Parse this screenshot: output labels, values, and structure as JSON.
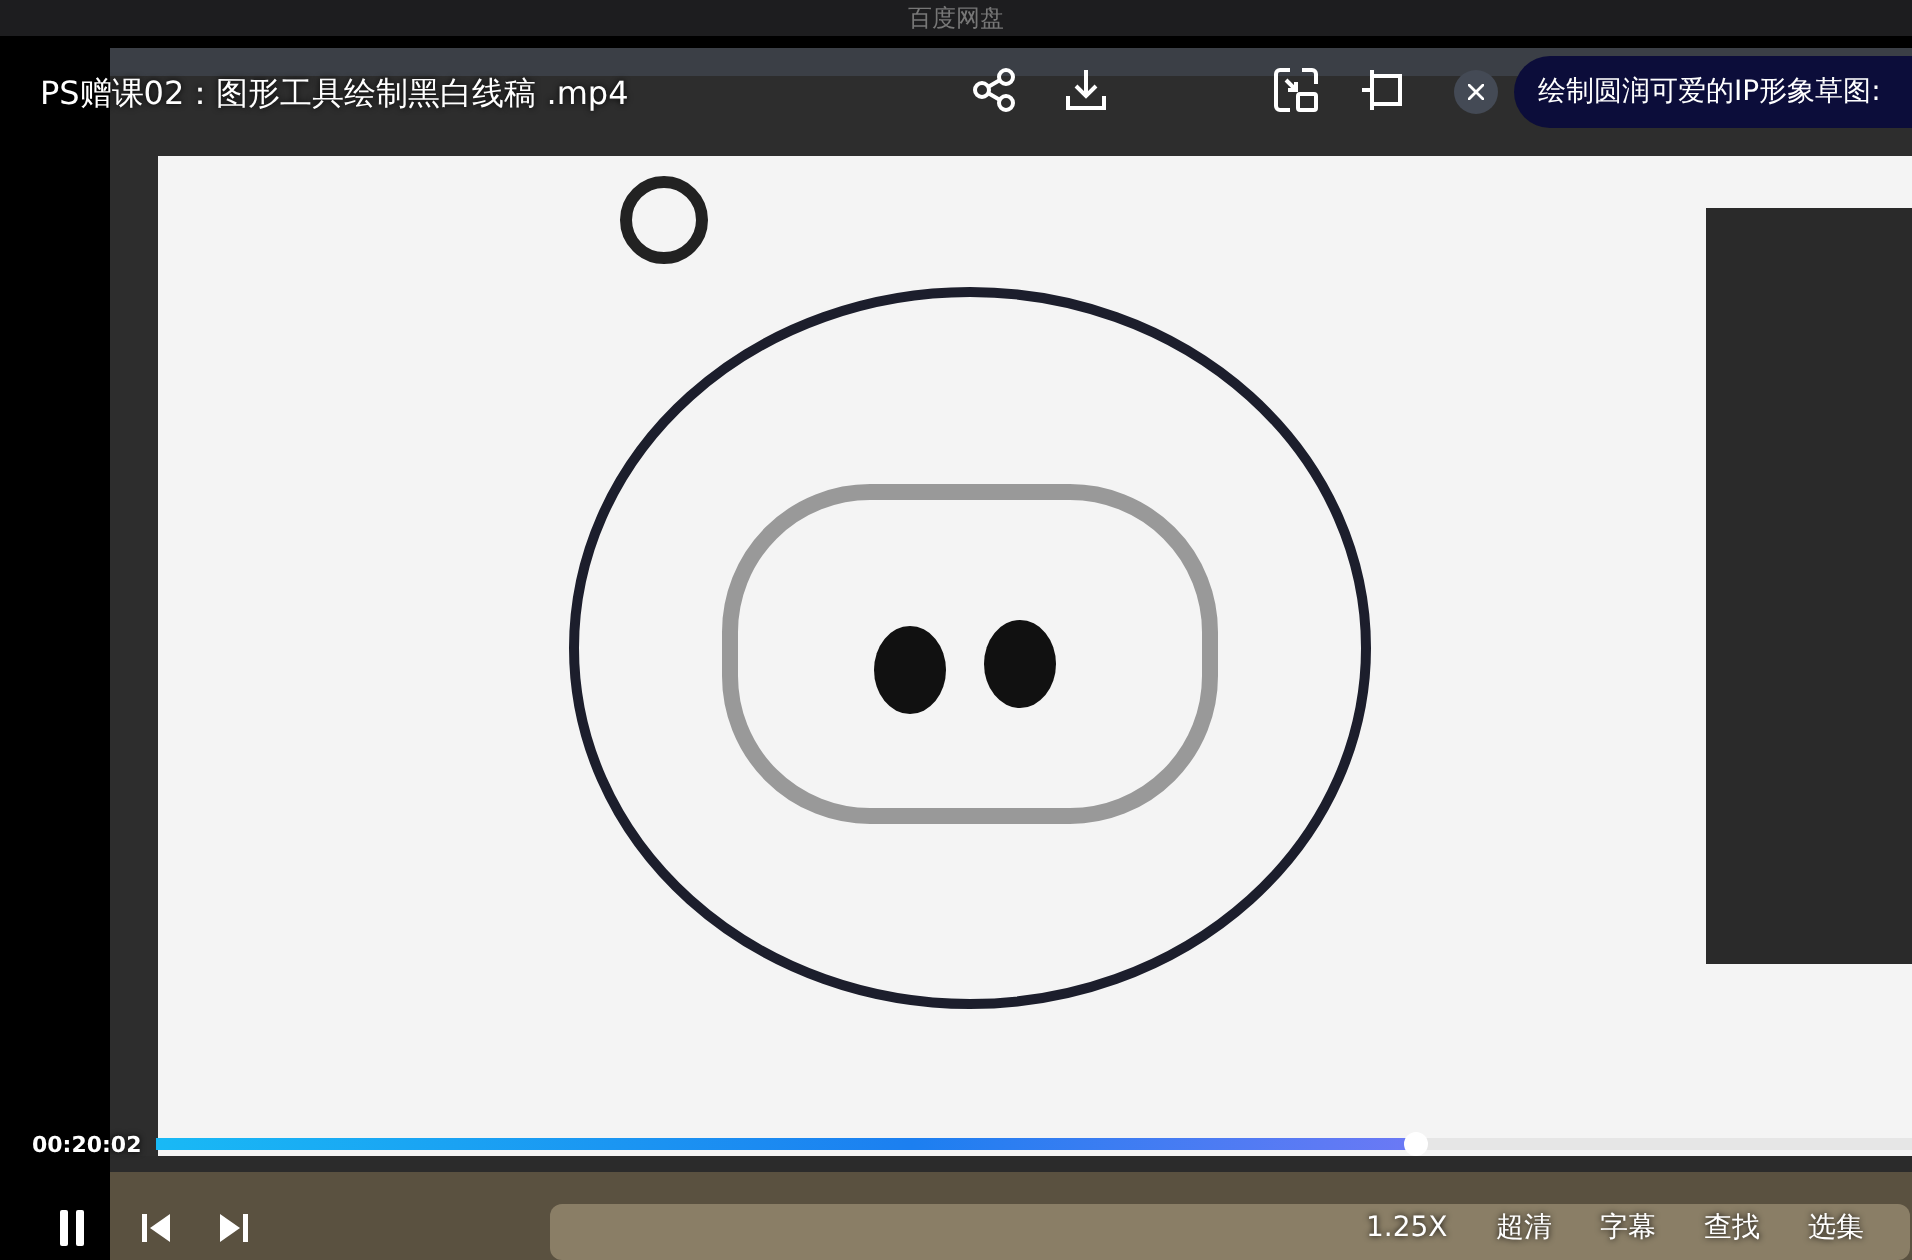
{
  "window": {
    "title": "百度网盘"
  },
  "player": {
    "title": "PS赠课02：图形工具绘制黑白线稿 .mp4",
    "chapter_button": "绘制圆润可爱的IP形象草图:",
    "time": "00:20:02",
    "progress": {
      "level": 0.717
    },
    "playing": true,
    "speed": "1.25X",
    "controls": [
      "超清",
      "字幕",
      "查找",
      "选集"
    ]
  }
}
